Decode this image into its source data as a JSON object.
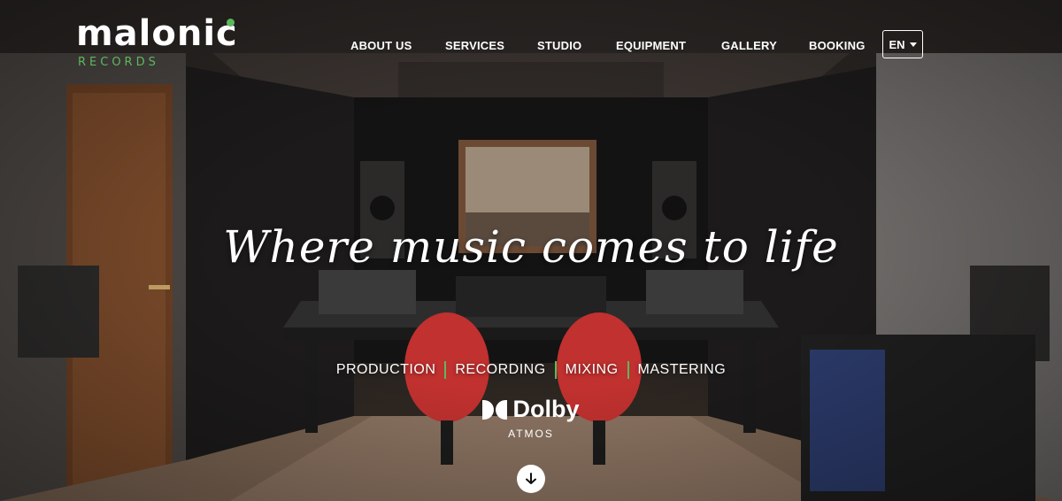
{
  "brand": {
    "name": "malonic",
    "sub": "RECORDS",
    "accent_color": "#5cb85c"
  },
  "nav": {
    "items": [
      {
        "label": "ABOUT US"
      },
      {
        "label": "SERVICES"
      },
      {
        "label": "STUDIO"
      },
      {
        "label": "EQUIPMENT"
      },
      {
        "label": "GALLERY"
      },
      {
        "label": "BOOKING"
      }
    ],
    "language": "EN"
  },
  "hero": {
    "tagline": "Where music comes to life",
    "services": [
      "PRODUCTION",
      "RECORDING",
      "MIXING",
      "MASTERING"
    ],
    "badge": {
      "name": "Dolby",
      "sub": "ATMOS"
    },
    "scroll_icon": "arrow-down-icon"
  },
  "colors": {
    "chair": "#c0312f",
    "wood": "#6b3f23"
  }
}
